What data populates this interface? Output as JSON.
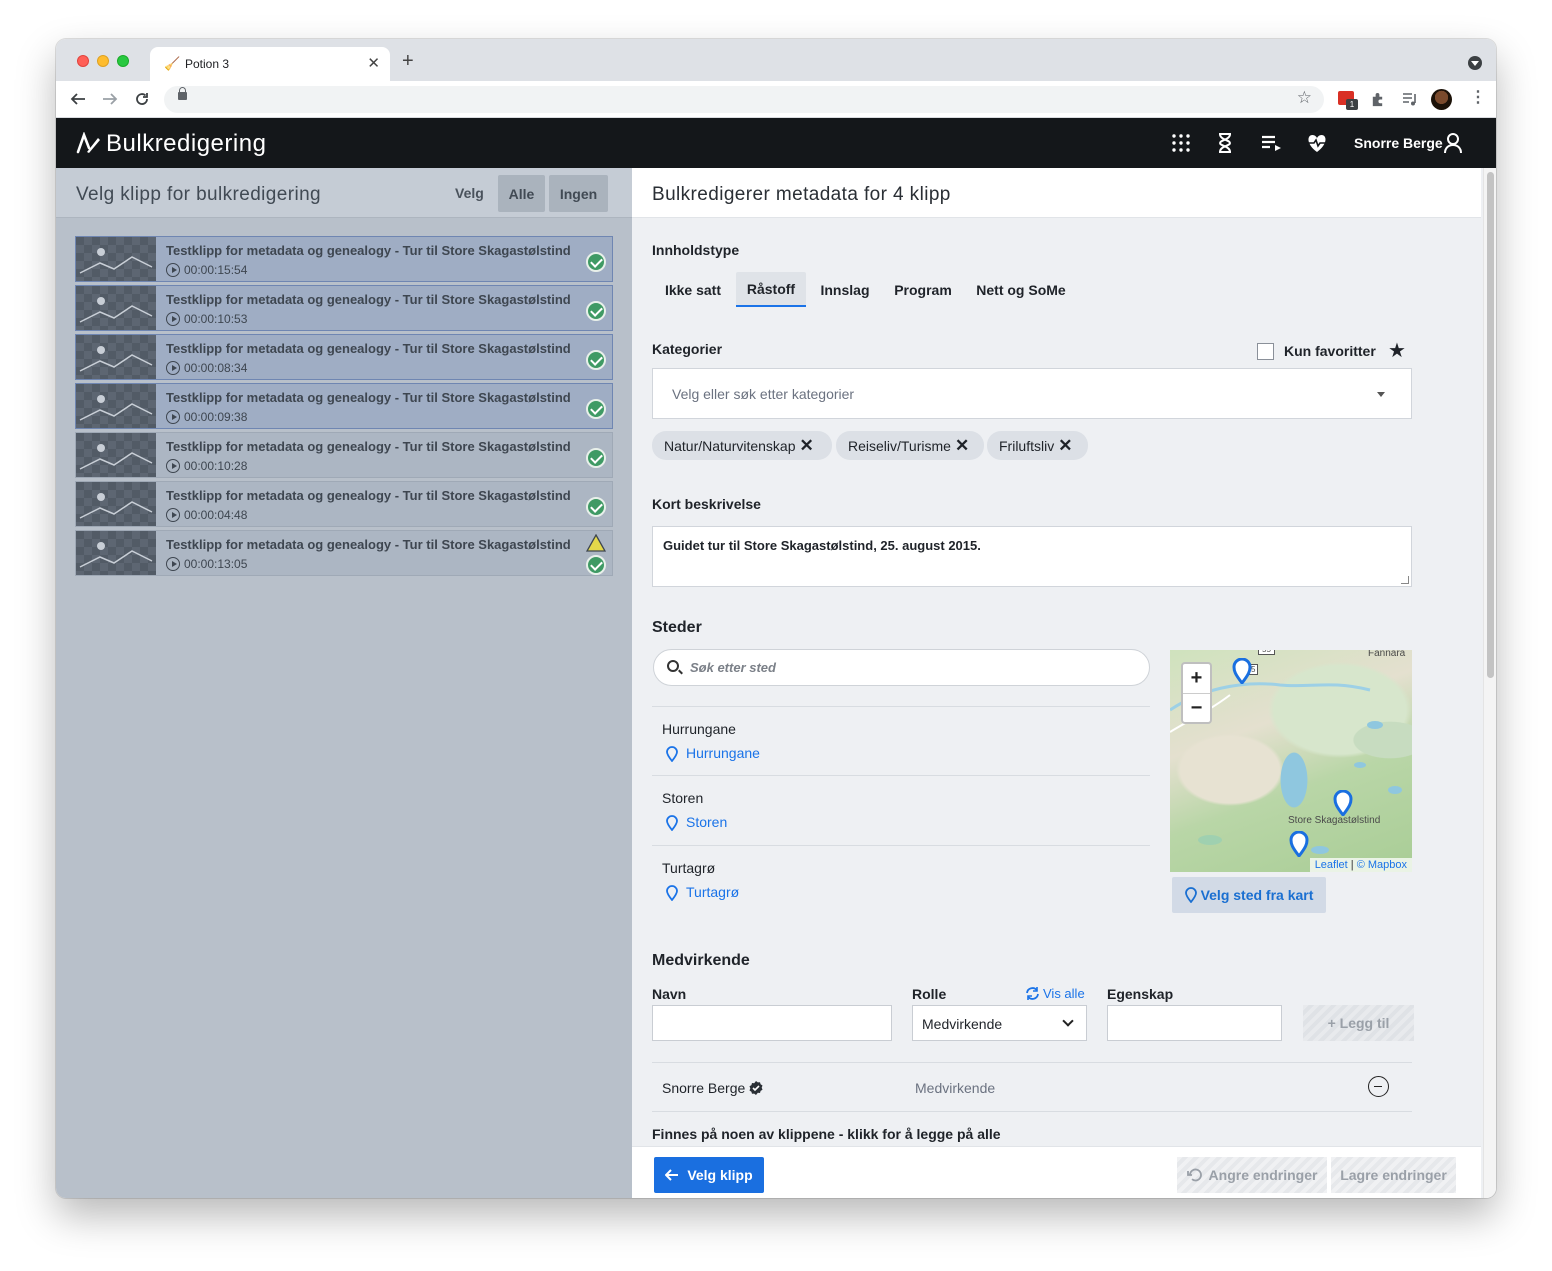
{
  "browser": {
    "tab_title": "Potion 3",
    "new_tab": "+",
    "tab_close": "✕",
    "ext_badge": "1"
  },
  "app": {
    "title": "Bulkredigering",
    "user_name": "Snorre Berge"
  },
  "left": {
    "title": "Velg klipp for bulkredigering",
    "velg_label": "Velg",
    "btn_all": "Alle",
    "btn_none": "Ingen",
    "clips": [
      {
        "title": "Testklipp for metadata og genealogy - Tur til Store Skagastølstind",
        "duration": "00:00:15:54",
        "selected": true,
        "warning": false
      },
      {
        "title": "Testklipp for metadata og genealogy - Tur til Store Skagastølstind",
        "duration": "00:00:10:53",
        "selected": true,
        "warning": false
      },
      {
        "title": "Testklipp for metadata og genealogy - Tur til Store Skagastølstind",
        "duration": "00:00:08:34",
        "selected": true,
        "warning": false
      },
      {
        "title": "Testklipp for metadata og genealogy - Tur til Store Skagastølstind",
        "duration": "00:00:09:38",
        "selected": true,
        "warning": false
      },
      {
        "title": "Testklipp for metadata og genealogy - Tur til Store Skagastølstind",
        "duration": "00:00:10:28",
        "selected": false,
        "warning": false
      },
      {
        "title": "Testklipp for metadata og genealogy - Tur til Store Skagastølstind",
        "duration": "00:00:04:48",
        "selected": false,
        "warning": false
      },
      {
        "title": "Testklipp for metadata og genealogy - Tur til Store Skagastølstind",
        "duration": "00:00:13:05",
        "selected": false,
        "warning": true
      }
    ]
  },
  "right": {
    "title": "Bulkredigerer metadata for 4 klipp",
    "content_type": {
      "label": "Innholdstype",
      "options": [
        "Ikke satt",
        "Råstoff",
        "Innslag",
        "Program",
        "Nett og SoMe"
      ],
      "active": "Råstoff"
    },
    "categories": {
      "label": "Kategorier",
      "favorites_label": "Kun favoritter",
      "placeholder": "Velg eller søk etter kategorier",
      "chips": [
        "Natur/Naturvitenskap",
        "Reiseliv/Turisme",
        "Friluftsliv"
      ]
    },
    "description": {
      "label": "Kort beskrivelse",
      "value": "Guidet tur til Store Skagastølstind, 25. august 2015."
    },
    "places": {
      "label": "Steder",
      "search_placeholder": "Søk etter sted",
      "items": [
        {
          "name": "Hurrungane",
          "link": "Hurrungane"
        },
        {
          "name": "Storen",
          "link": "Storen"
        },
        {
          "name": "Turtagrø",
          "link": "Turtagrø"
        }
      ],
      "map": {
        "zoom_in": "+",
        "zoom_out": "−",
        "label_top": "Fannara",
        "label_peak": "Store Skagastølstind",
        "road_55": "55",
        "road_mark": "5",
        "attr_leaflet": "Leaflet",
        "attr_sep": " | ",
        "attr_mapbox": "© Mapbox"
      },
      "pick_from_map": "Velg sted fra kart"
    },
    "contributors": {
      "label": "Medvirkende",
      "name_label": "Navn",
      "role_label": "Rolle",
      "show_all": "Vis alle",
      "property_label": "Egenskap",
      "role_value": "Medvirkende",
      "add_button": "+ Legg til",
      "rows": [
        {
          "name": "Snorre Berge",
          "role": "Medvirkende"
        }
      ],
      "found_label": "Finnes på noen av klippene - klikk for å legge på alle"
    },
    "footer": {
      "pick_clips": "Velg klipp",
      "undo": "Angre endringer",
      "save": "Lagre endringer"
    }
  }
}
